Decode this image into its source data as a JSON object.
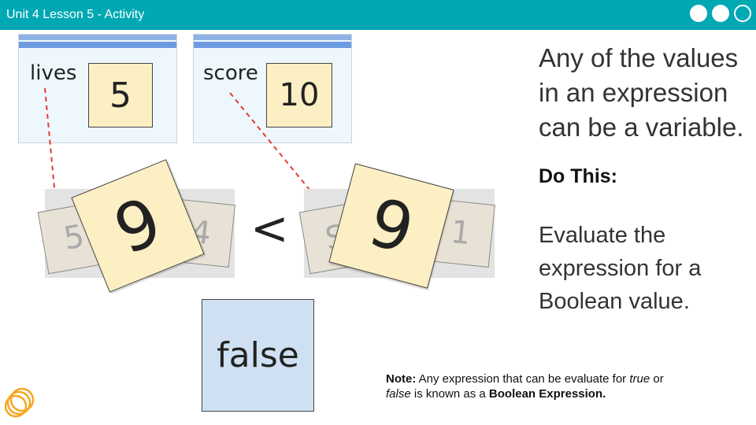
{
  "header": {
    "title": "Unit 4 Lesson 5 - Activity"
  },
  "variables": [
    {
      "name": "lives",
      "value": "5"
    },
    {
      "name": "score",
      "value": "10"
    }
  ],
  "expression": {
    "left_ghost": [
      "5",
      "4"
    ],
    "right_ghost": [
      "S",
      "1"
    ],
    "left_card": "9",
    "operator": "<",
    "right_card": "9"
  },
  "result": {
    "value": "false"
  },
  "instructions": {
    "intro": "Any of the values in an expression can be a variable.",
    "do_this_label": "Do This:",
    "task": "Evaluate the expression for a Boolean value."
  },
  "footnote": {
    "note_label": "Note:",
    "text_1": "Any expression that can be evaluate for",
    "true_word": "true",
    "or_word": "or",
    "false_word": "false",
    "text_2": "is known as a",
    "bold_term": "Boolean Expression."
  },
  "colors": {
    "header_bg": "#00a8b4",
    "note_yellow": "#fdefc4",
    "result_blue": "#cfe0f2",
    "arrow_red": "#e53935",
    "logo_orange": "#f5a623"
  },
  "icons": {
    "logo": "orange-rings-logo-icon",
    "nav": "slide-dots-icon"
  }
}
